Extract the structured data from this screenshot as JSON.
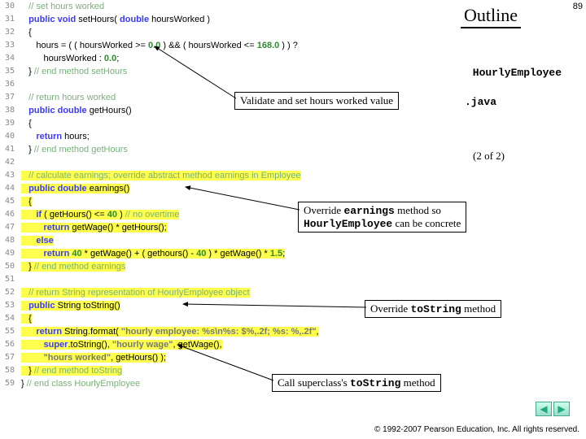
{
  "slide_number": "89",
  "outline": "Outline",
  "file_label": "HourlyEmployee",
  "file_ext": ".java",
  "pager": "(2 of  2)",
  "footer": "© 1992-2007 Pearson Education, Inc.  All rights reserved.",
  "line_numbers": [
    "30",
    "31",
    "32",
    "33",
    "34",
    "35",
    "36",
    "37",
    "38",
    "39",
    "40",
    "41",
    "42",
    "43",
    "44",
    "45",
    "46",
    "47",
    "48",
    "49",
    "50",
    "51",
    "52",
    "53",
    "54",
    "55",
    "56",
    "57",
    "58",
    "59"
  ],
  "callouts": {
    "validate": "Validate and set hours worked value",
    "earnings_a": "Override ",
    "earnings_b": "earnings",
    "earnings_c": " method so",
    "earnings_d": "HourlyEmployee",
    "earnings_e": " can be concrete",
    "tostr_a": "Override ",
    "tostr_b": "toString",
    "tostr_c": " method",
    "super_a": "Call superclass's ",
    "super_b": "toString",
    "super_c": " method"
  },
  "code": {
    "l30": "   // set hours worked",
    "l31_a": "   public void",
    "l31_b": " setHours( ",
    "l31_c": "double",
    "l31_d": " hoursWorked )",
    "l32": "   {",
    "l33_a": "      hours = ( ( hoursWorked >= ",
    "l33_b": "0.0",
    "l33_c": " ) && ( hoursWorked <= ",
    "l33_d": "168.0",
    "l33_e": " ) ) ?",
    "l34_a": "         hoursWorked : ",
    "l34_b": "0.0",
    "l34_c": ";",
    "l35_a": "   } ",
    "l35_b": "// end method setHours",
    "l37": "   // return hours worked",
    "l38_a": "   public double",
    "l38_b": " getHours()",
    "l39": "   {",
    "l40_a": "      return",
    "l40_b": " hours;",
    "l41_a": "   } ",
    "l41_b": "// end method getHours",
    "l43": "   // calculate earnings; override abstract method earnings in Employee",
    "l44_a": "   public double",
    "l44_b": " earnings()",
    "l45": "   {",
    "l46_a": "      if",
    "l46_b": " ( getHours() <= ",
    "l46_c": "40",
    "l46_d": " ) ",
    "l46_e": "// no overtime",
    "l47_a": "         return",
    "l47_b": " getWage() * getHours();",
    "l48": "      else",
    "l49_a": "         return ",
    "l49_b": "40",
    "l49_c": " * getWage() + ( gethours() - ",
    "l49_d": "40",
    "l49_e": " ) * getWage() * ",
    "l49_f": "1.5",
    "l49_g": ";",
    "l50_a": "   } ",
    "l50_b": "// end method earnings",
    "l52": "   // return String representation of HourlyEmployee object",
    "l53_a": "   public",
    "l53_b": " String toString()",
    "l54": "   {",
    "l55_a": "      return",
    "l55_b": " String.format( ",
    "l55_c": "\"hourly employee: %s\\n%s: $%,.2f; %s: %,.2f\"",
    "l55_d": ",",
    "l56_a": "         super",
    "l56_b": ".toString(), ",
    "l56_c": "\"hourly wage\"",
    "l56_d": ", getWage(),",
    "l57_a": "         ",
    "l57_b": "\"hours worked\"",
    "l57_c": ", getHours() );",
    "l58_a": "   } ",
    "l58_b": "// end method toString",
    "l59_a": "} ",
    "l59_b": "// end class HourlyEmployee"
  }
}
